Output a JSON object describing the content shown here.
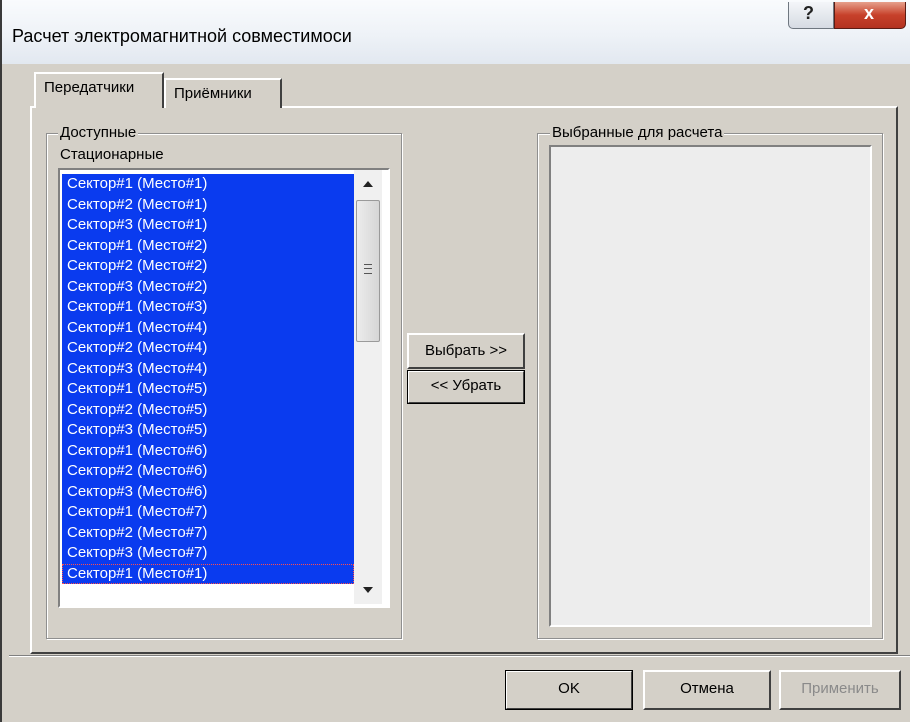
{
  "window": {
    "title": "Расчет электромагнитной совместимоси"
  },
  "titlebar_buttons": {
    "help_glyph": "?",
    "close_glyph": "x"
  },
  "tabs": [
    {
      "label": "Передатчики",
      "active": true
    },
    {
      "label": "Приёмники",
      "active": false
    }
  ],
  "available": {
    "group_label": "Доступные",
    "list_label": "Стационарные",
    "items": [
      "Сектор#1 (Место#1)",
      "Сектор#2 (Место#1)",
      "Сектор#3 (Место#1)",
      "Сектор#1 (Место#2)",
      "Сектор#2 (Место#2)",
      "Сектор#3 (Место#2)",
      "Сектор#1 (Место#3)",
      "Сектор#1 (Место#4)",
      "Сектор#2 (Место#4)",
      "Сектор#3 (Место#4)",
      "Сектор#1 (Место#5)",
      "Сектор#2 (Место#5)",
      "Сектор#3 (Место#5)",
      "Сектор#1 (Место#6)",
      "Сектор#2 (Место#6)",
      "Сектор#3 (Место#6)",
      "Сектор#1 (Место#7)",
      "Сектор#2 (Место#7)",
      "Сектор#3 (Место#7)",
      "Сектор#1 (Место#1)"
    ]
  },
  "selected": {
    "group_label": "Выбранные для расчета",
    "items": []
  },
  "buttons": {
    "select": "Выбрать >>",
    "remove": "<< Убрать",
    "ok": "OK",
    "cancel": "Отмена",
    "apply": "Применить"
  },
  "colors": {
    "selection": "#0a3bef",
    "close_button": "#c7412a"
  }
}
